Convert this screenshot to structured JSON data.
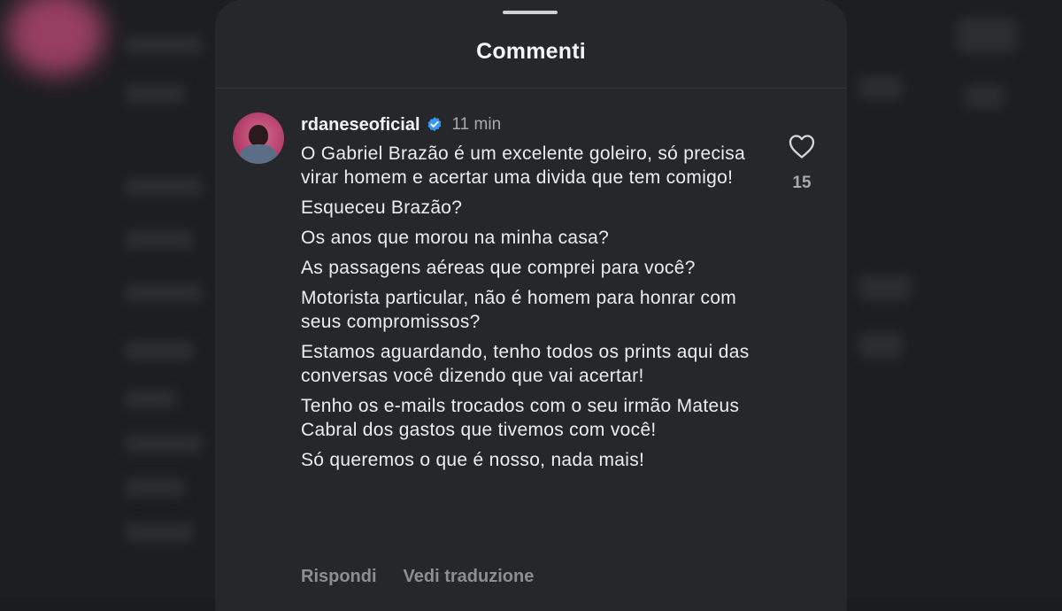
{
  "sheet": {
    "title": "Commenti"
  },
  "comment": {
    "username": "rdaneseoficial",
    "verified_icon": "verified-badge-icon",
    "timestamp": "11 min",
    "lines": [
      "O Gabriel Brazão é um excelente goleiro, só precisa virar homem e acertar uma divida que tem comigo!",
      "Esqueceu Brazão?",
      "Os anos que morou na minha casa?",
      "As passagens aéreas que comprei para você?",
      "Motorista particular, não é homem para honrar com seus compromissos?",
      "Estamos aguardando, tenho todos os prints aqui das conversas você dizendo que vai acertar!",
      "Tenho os e-mails trocados com o seu irmão Mateus Cabral dos gastos que tivemos com você!",
      "Só queremos o que é nosso, nada mais!"
    ],
    "like_icon": "heart-outline-icon",
    "like_count": "15",
    "reply_label": "Rispondi",
    "translate_label": "Vedi traduzione"
  },
  "colors": {
    "sheet_bg": "#25272b",
    "backdrop": "#1d1e21",
    "verified_blue": "#3897f0",
    "text_primary": "#ededee",
    "text_muted": "#8c8e93"
  }
}
